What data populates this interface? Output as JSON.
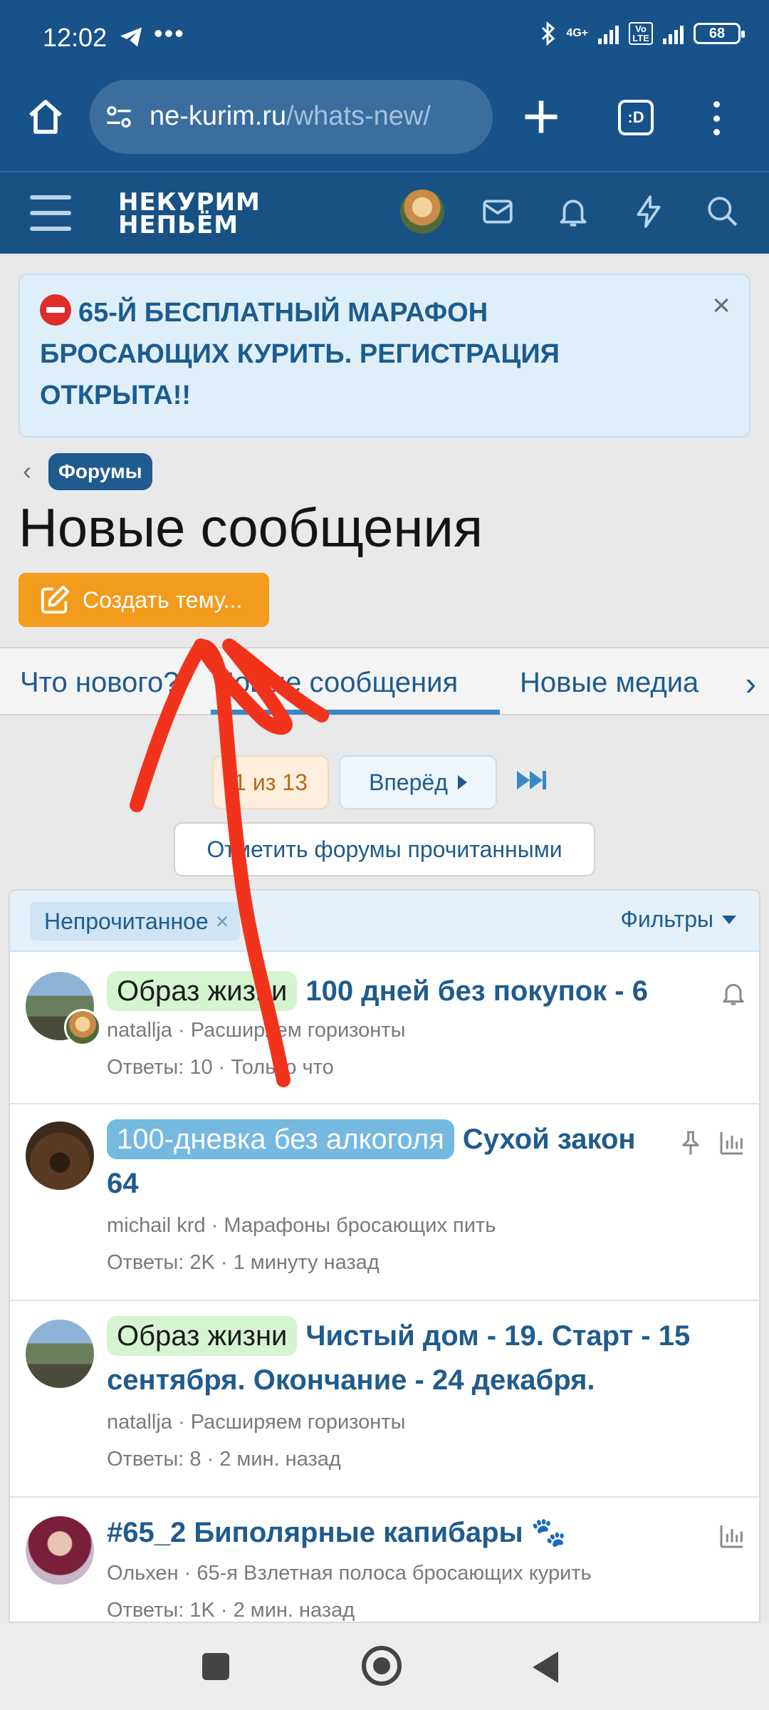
{
  "status_bar": {
    "time": "12:02",
    "dots": "•••",
    "network": "4G+",
    "volte": "Vo LTE",
    "battery": "68"
  },
  "browser": {
    "url_domain": "ne-kurim.ru",
    "url_path": "/whats-new/",
    "tabs_label": ":D"
  },
  "site_header": {
    "logo_line1": "НЕКУРИМ",
    "logo_line2": "НЕПЬЁМ"
  },
  "notice": {
    "text": "65-Й БЕСПЛАТНЫЙ МАРАФОН БРОСАЮЩИХ КУРИТЬ. РЕГИСТРАЦИЯ ОТКРЫТА!!",
    "close": "×"
  },
  "breadcrumb": {
    "chevron": "‹",
    "label": "Форумы"
  },
  "page_title": "Новые сообщения",
  "create_button": "Создать тему...",
  "tabs": [
    {
      "label": "Что нового?"
    },
    {
      "label": "Новые сообщения"
    },
    {
      "label": "Новые медиа"
    }
  ],
  "tabs_chevron": "›",
  "pagination": {
    "current": "1 из 13",
    "next": "Вперёд"
  },
  "mark_read": "Отметить форумы прочитанными",
  "filter_bar": {
    "chip": "Непрочитанное",
    "chip_close": "×",
    "filters": "Фильтры"
  },
  "threads": [
    {
      "label": "Образ жизни",
      "title": "100 дней без покупок - 6",
      "author": "natallja",
      "forum": "Расширяем горизонты",
      "meta": "Ответы: 10 · Только что"
    },
    {
      "label": "100-дневка без алкоголя",
      "title": "Сухой закон 64",
      "author": "michail krd",
      "forum": "Марафоны бросающих пить",
      "meta": "Ответы: 2K · 1 минуту назад"
    },
    {
      "label": "Образ жизни",
      "title": "Чистый дом - 19. Старт - 15 сентября. Окончание - 24 декабря.",
      "author": "natallja",
      "forum": "Расширяем горизонты",
      "meta": "Ответы: 8 · 2 мин. назад"
    },
    {
      "label": "",
      "title": "#65_2 Биполярные капибары 🐾",
      "author": "Ольхен",
      "forum": "65-я Взлетная полоса бросающих курить",
      "meta": "Ответы: 1K · 2 мин. назад"
    }
  ],
  "meta_separator": " · ",
  "colors": {
    "brand": "#185284",
    "accent_orange": "#f39b1c",
    "link": "#1f5b8e",
    "annotation_red": "#f2331c"
  }
}
